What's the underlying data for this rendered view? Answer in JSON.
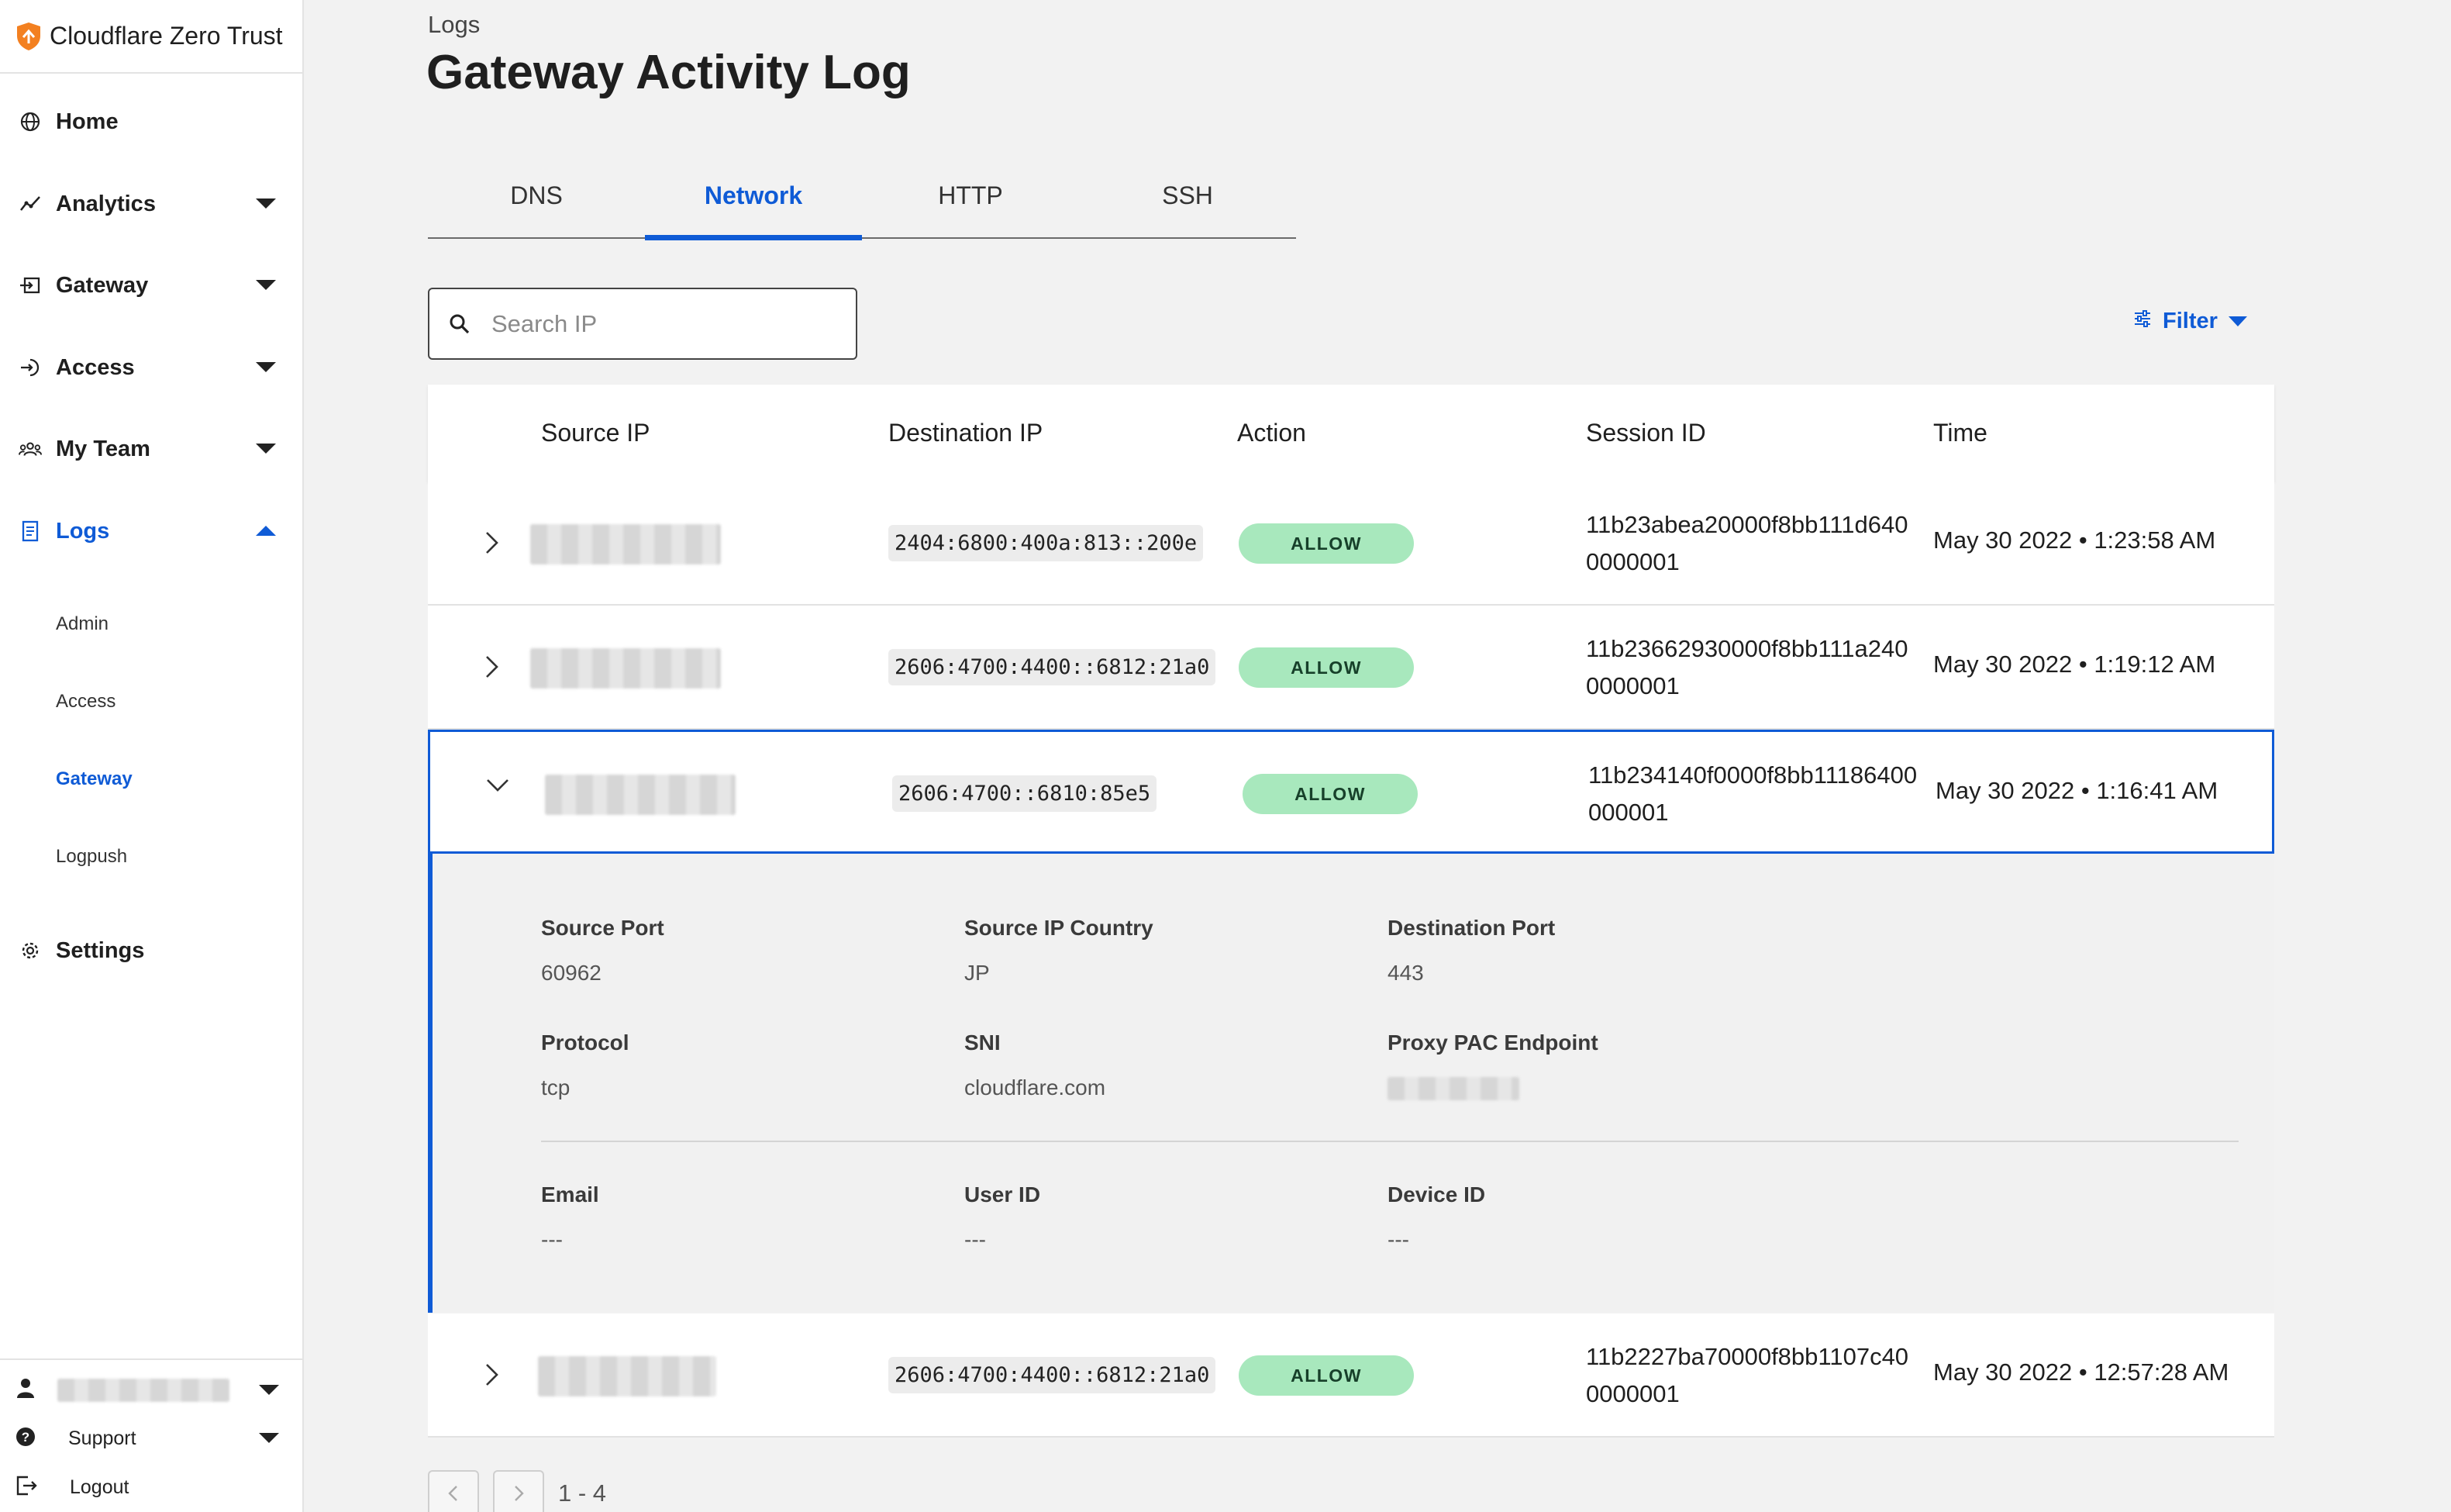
{
  "app": {
    "title": "Cloudflare Zero Trust"
  },
  "sidebar": {
    "items": [
      {
        "label": "Home",
        "icon": "globe-icon"
      },
      {
        "label": "Analytics",
        "icon": "analytics-icon"
      },
      {
        "label": "Gateway",
        "icon": "gateway-icon"
      },
      {
        "label": "Access",
        "icon": "access-icon"
      },
      {
        "label": "My Team",
        "icon": "team-icon"
      },
      {
        "label": "Logs",
        "icon": "logs-icon"
      },
      {
        "label": "Settings",
        "icon": "gear-icon"
      }
    ],
    "logs_subitems": [
      "Admin",
      "Access",
      "Gateway",
      "Logpush"
    ],
    "active_subitem": "Gateway",
    "bottom": {
      "support": "Support",
      "logout": "Logout"
    }
  },
  "page": {
    "breadcrumb": "Logs",
    "title": "Gateway Activity Log"
  },
  "tabs": [
    {
      "label": "DNS"
    },
    {
      "label": "Network"
    },
    {
      "label": "HTTP"
    },
    {
      "label": "SSH"
    }
  ],
  "active_tab": "Network",
  "search": {
    "placeholder": "Search IP",
    "value": ""
  },
  "filter": {
    "label": "Filter"
  },
  "table": {
    "columns": [
      "Source IP",
      "Destination IP",
      "Action",
      "Session ID",
      "Time"
    ],
    "rows": [
      {
        "destination_ip": "2404:6800:400a:813::200e",
        "action": "ALLOW",
        "session_id": "11b23abea20000f8bb111d6400000001",
        "time": "May 30 2022 • 1:23:58 AM"
      },
      {
        "destination_ip": "2606:4700:4400::6812:21a0",
        "action": "ALLOW",
        "session_id": "11b23662930000f8bb111a2400000001",
        "time": "May 30 2022 • 1:19:12 AM"
      },
      {
        "destination_ip": "2606:4700::6810:85e5",
        "action": "ALLOW",
        "session_id": "11b234140f0000f8bb11186400000001",
        "time": "May 30 2022 • 1:16:41 AM"
      },
      {
        "destination_ip": "2606:4700:4400::6812:21a0",
        "action": "ALLOW",
        "session_id": "11b2227ba70000f8bb1107c400000001",
        "time": "May 30 2022 • 12:57:28 AM"
      }
    ]
  },
  "details": {
    "source_port": {
      "label": "Source Port",
      "value": "60962"
    },
    "source_ip_country": {
      "label": "Source IP Country",
      "value": "JP"
    },
    "destination_port": {
      "label": "Destination Port",
      "value": "443"
    },
    "protocol": {
      "label": "Protocol",
      "value": "tcp"
    },
    "sni": {
      "label": "SNI",
      "value": "cloudflare.com"
    },
    "proxy_pac_endpoint": {
      "label": "Proxy PAC Endpoint"
    },
    "email": {
      "label": "Email",
      "value": "---"
    },
    "user_id": {
      "label": "User ID",
      "value": "---"
    },
    "device_id": {
      "label": "Device ID",
      "value": "---"
    }
  },
  "pagination": {
    "range": "1 - 4"
  },
  "colors": {
    "accent": "#0f5bd6",
    "allow_badge": "#a8e8bd",
    "brand_orange": "#f38020"
  }
}
